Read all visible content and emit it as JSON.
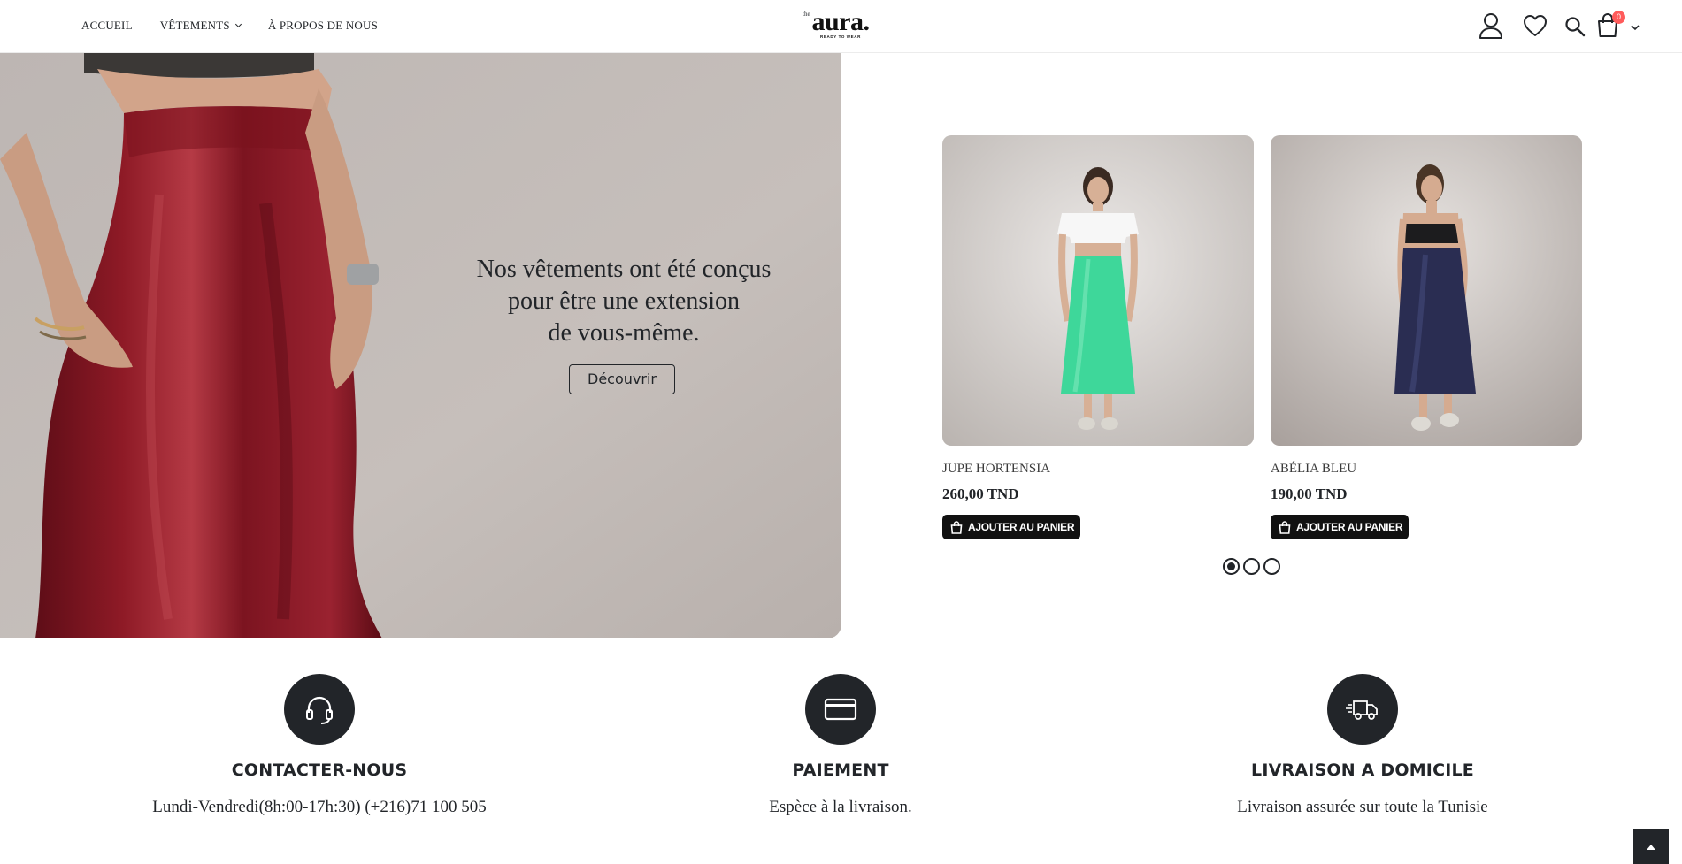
{
  "header": {
    "nav": [
      {
        "label": "ACCUEIL"
      },
      {
        "label": "VÊTEMENTS"
      },
      {
        "label": "À PROPOS DE NOUS"
      }
    ],
    "logo": {
      "prefix": "the",
      "name": "aura.",
      "tagline": "READY TO WEAR"
    },
    "cart_count": "0",
    "icons": [
      "user-icon",
      "heart-icon",
      "search-icon",
      "cart-icon",
      "chevron-down-icon"
    ]
  },
  "hero": {
    "line1": "Nos vêtements ont été conçus",
    "line2": "pour être une extension",
    "line3": "de vous-même.",
    "button": "Découvrir"
  },
  "products": [
    {
      "name": "JUPE HORTENSIA",
      "price": "260,00 TND",
      "button": "AJOUTER AU PANIER",
      "skirt_color": "#3ed79a"
    },
    {
      "name": "ABÉLIA BLEU",
      "price": "190,00 TND",
      "button": "AJOUTER AU PANIER",
      "skirt_color": "#2a2d52"
    }
  ],
  "carousel": {
    "pages": 3,
    "active": 1
  },
  "features": [
    {
      "title": "CONTACTER-NOUS",
      "desc": "Lundi-Vendredi(8h:00-17h:30) (+216)71 100 505",
      "icon": "headset-icon"
    },
    {
      "title": "PAIEMENT",
      "desc": "Espèce à la livraison.",
      "icon": "credit-card-icon"
    },
    {
      "title": "LIVRAISON A DOMICILE",
      "desc": "Livraison assurée sur toute la Tunisie",
      "icon": "delivery-truck-icon"
    }
  ],
  "colors": {
    "dark": "#222529",
    "hero_bg": "#c3bbb7",
    "skirt": "#8e1a26",
    "badge": "#ff5b5b"
  }
}
